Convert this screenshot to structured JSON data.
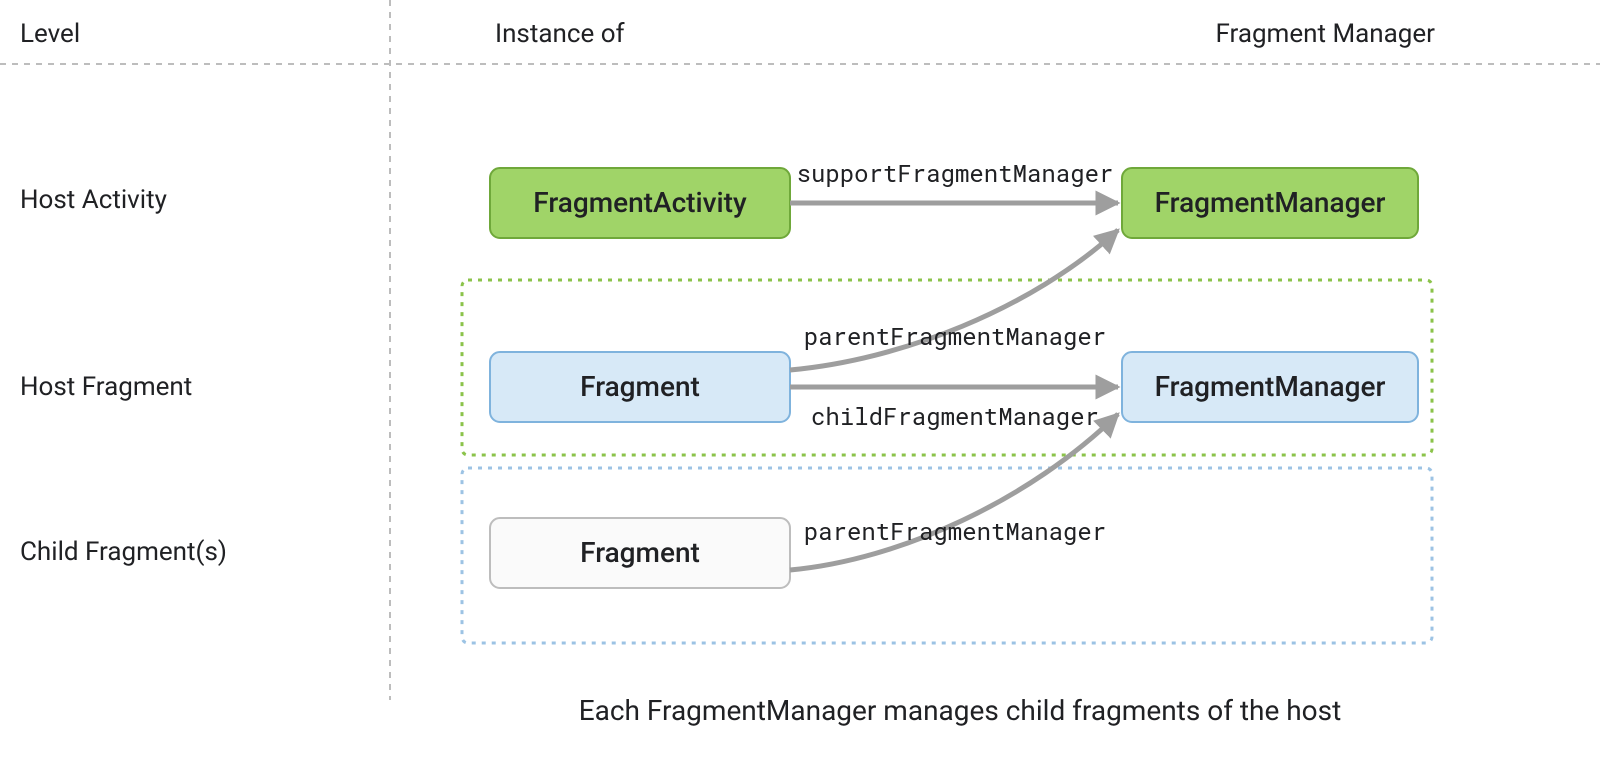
{
  "headers": {
    "level": "Level",
    "instance": "Instance of",
    "manager": "Fragment Manager"
  },
  "levels": {
    "hostActivity": "Host Activity",
    "hostFragment": "Host Fragment",
    "childFragments": "Child Fragment(s)"
  },
  "nodes": {
    "fragmentActivity": "FragmentActivity",
    "hostFragment": "Fragment",
    "childFragment": "Fragment",
    "fmActivity": "FragmentManager",
    "fmFragment": "FragmentManager"
  },
  "edges": {
    "supportFM": "supportFragmentManager",
    "parentFM1": "parentFragmentManager",
    "childFM": "childFragmentManager",
    "parentFM2": "parentFragmentManager"
  },
  "caption": "Each FragmentManager manages child fragments of the host"
}
